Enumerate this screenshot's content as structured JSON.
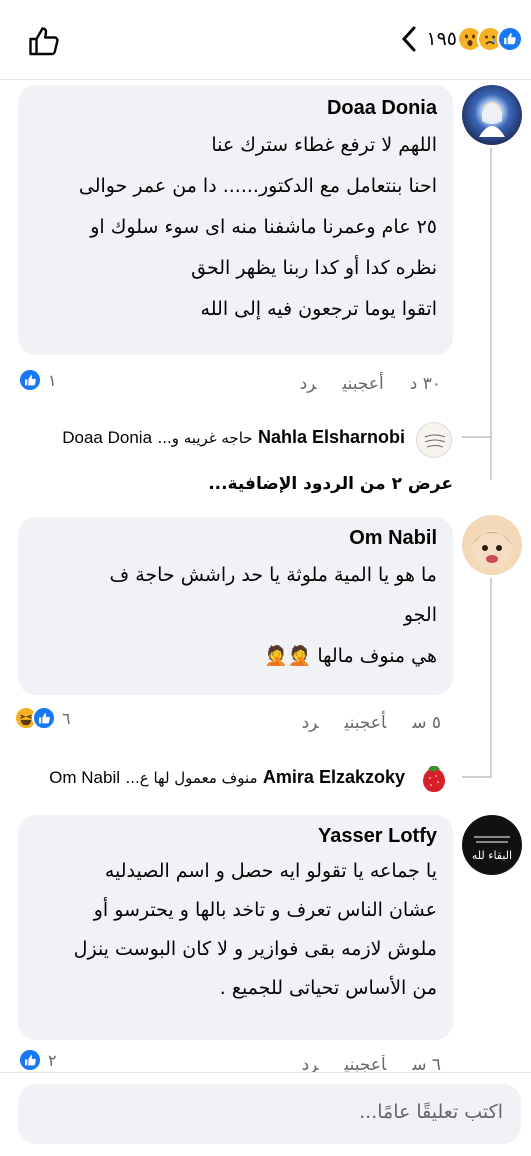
{
  "header": {
    "reaction_count": "١٩٥",
    "reaction_icons": [
      "like-icon",
      "sad-emoji-icon",
      "wow-emoji-icon"
    ],
    "like_icon": "thumbs-up-outline-icon",
    "back_icon": "chevron-left-icon"
  },
  "comments": [
    {
      "author": "Doaa Donia",
      "lines": [
        "اللهم لا ترفع غطاء سترك عنا",
        "احنا بنتعامل مع الدكتور...... دا من عمر حوالى",
        "٢٥ عام وعمرنا ماشفنا منه اى سوء سلوك او",
        "نظره كدا أو كدا ربنا يظهر الحق",
        "اتقوا يوما ترجعون فيه إلى الله"
      ],
      "time": "٣٠ د",
      "like_label": "أعجبني",
      "reply_label": "رد",
      "reaction_count": "١",
      "reply_preview": {
        "name": "Nahla Elsharnobi",
        "text": "حاجه غريبه و...",
        "to": "Doaa Donia"
      },
      "more_replies": "عرض ٢ من الردود الإضافية..."
    },
    {
      "author": "Om Nabil",
      "lines": [
        "ما هو يا المية ملوثة يا حد راشش حاجة ف",
        "الجو",
        "هي منوف مالها 🤦🤦"
      ],
      "time": "٥ س",
      "like_label": "أعجبني",
      "reply_label": "رد",
      "reaction_count": "٦",
      "reply_preview": {
        "name": "Amira Elzakzoky",
        "text": "منوف معمول لها ع...",
        "to": "Om Nabil"
      }
    },
    {
      "author": "Yasser Lotfy",
      "lines": [
        "يا جماعه يا تقولو ايه حصل و اسم الصيدليه",
        "عشان الناس تعرف و تاخد بالها و يحترسو أو",
        "ملوش لازمه بقى فوازير و لا كان البوست ينزل",
        "من الأساس تحياتى للجميع ."
      ],
      "time": "٦ س",
      "like_label": "أعجبني",
      "reply_label": "رد",
      "reaction_count": "٢"
    }
  ],
  "composer": {
    "placeholder": "اكتب تعليقًا عامًا..."
  },
  "colors": {
    "like_blue": "#1877f2",
    "bubble_bg": "#f0f2f5",
    "meta_gray": "#65676b"
  }
}
